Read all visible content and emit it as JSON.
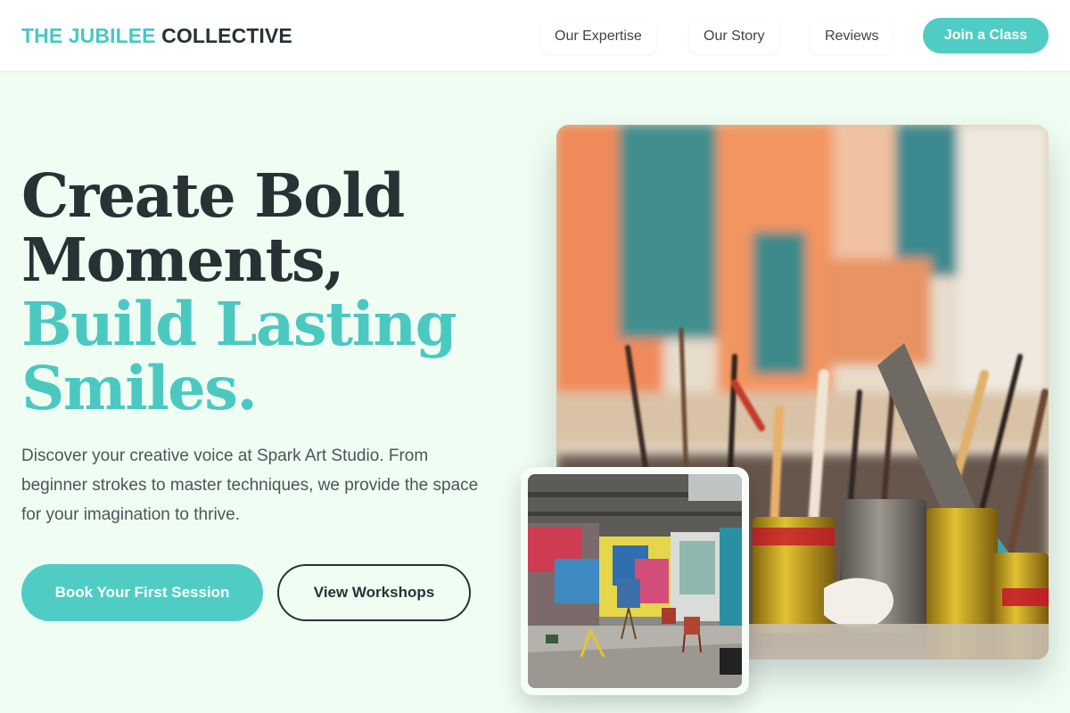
{
  "header": {
    "brand_accent": "THE JUBILEE",
    "brand_rest": "COLLECTIVE",
    "nav": [
      {
        "label": "Our Expertise"
      },
      {
        "label": "Our Story"
      },
      {
        "label": "Reviews"
      }
    ],
    "cta_label": "Join a Class"
  },
  "hero": {
    "headline_lines": [
      {
        "text": "Create Bold",
        "tone": "dark"
      },
      {
        "text": "Moments,",
        "tone": "dark"
      },
      {
        "text": "Build Lasting",
        "tone": "teal"
      },
      {
        "text": "Smiles.",
        "tone": "teal"
      }
    ],
    "description": "Discover your creative voice at Spark Art Studio. From beginner strokes to master techniques, we provide the space for your imagination to thrive.",
    "primary_button": "Book Your First Session",
    "secondary_button": "View Workshops"
  },
  "images": {
    "main": {
      "icon": "art-supplies-photo"
    },
    "inset": {
      "icon": "graffiti-studio-photo"
    }
  },
  "colors": {
    "accent": "#4fcdc5",
    "dark_text": "#263234",
    "background": "#effdf3"
  }
}
